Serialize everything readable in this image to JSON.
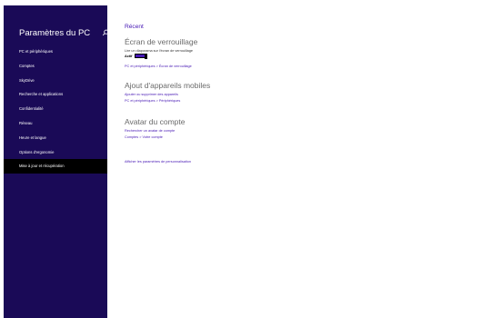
{
  "sidebar": {
    "title": "Paramètres du PC",
    "items": [
      {
        "label": "PC et périphériques"
      },
      {
        "label": "Comptes"
      },
      {
        "label": "SkyDrive"
      },
      {
        "label": "Recherche et applications"
      },
      {
        "label": "Confidentialité"
      },
      {
        "label": "Réseau"
      },
      {
        "label": "Heure et langue"
      },
      {
        "label": "Options d'ergonomie"
      },
      {
        "label": "Mise à jour et récupération"
      }
    ]
  },
  "main": {
    "recent_heading": "Récent",
    "lock_screen": {
      "title": "Écran de verrouillage",
      "description": "Lire un diaporama sur l'écran de verrouillage",
      "toggle_label": "Actif",
      "link": "PC et périphériques > Écran de verrouillage"
    },
    "devices": {
      "title": "Ajout d'appareils mobiles",
      "link1": "Ajouter ou supprimer des appareils",
      "link2": "PC et périphériques > Périphériques"
    },
    "avatar": {
      "title": "Avatar du compte",
      "link1": "Rechercher un avatar de compte",
      "link2": "Comptes > Votre compte"
    },
    "personalization_link": "Afficher les paramètres de personnalisation"
  },
  "colors": {
    "sidebar_bg": "#1a0a57",
    "accent": "#4617b4",
    "selected_bg": "#000000"
  }
}
